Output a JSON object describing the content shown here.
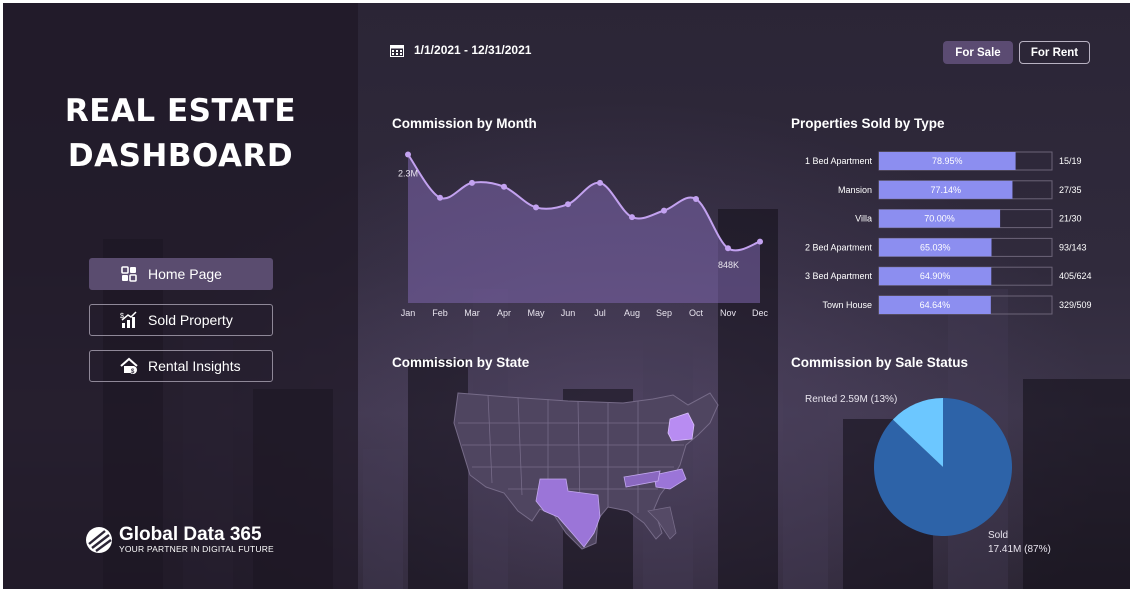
{
  "dashboard": {
    "title_line1": "REAL ESTATE",
    "title_line2": "DASHBOARD"
  },
  "nav": [
    {
      "label": "Home Page",
      "icon": "dashboard-icon",
      "active": true
    },
    {
      "label": "Sold Property",
      "icon": "growth-chart-icon",
      "active": false
    },
    {
      "label": "Rental Insights",
      "icon": "house-dollar-icon",
      "active": false
    }
  ],
  "brand": {
    "name": "Global Data 365",
    "tagline": "YOUR PARTNER IN DIGITAL FUTURE",
    "logo_icon": "globe-logo-icon"
  },
  "filters": {
    "date_range": "1/1/2021 - 12/31/2021",
    "date_icon": "calendar-icon",
    "for_sale": "For Sale",
    "for_rent": "For Rent",
    "selected": "For Sale"
  },
  "colors": {
    "accent": "#5b4b72",
    "line": "#c3a2f0",
    "area": "#7e66ad",
    "bar": "#8c8ef0",
    "pie_sold": "#2d63a8",
    "pie_rented": "#6cc7ff",
    "map_highlight": "#9b75d8"
  },
  "chart_data": [
    {
      "type": "area",
      "title": "Commission by Month",
      "categories": [
        "Jan",
        "Feb",
        "Mar",
        "Apr",
        "May",
        "Jun",
        "Jul",
        "Aug",
        "Sep",
        "Oct",
        "Nov",
        "Dec"
      ],
      "values": [
        2.3,
        1.63,
        1.86,
        1.8,
        1.48,
        1.53,
        1.86,
        1.33,
        1.43,
        1.61,
        0.848,
        0.95
      ],
      "value_unit": "M",
      "data_labels": [
        {
          "index": 0,
          "text": "2.3M"
        },
        {
          "index": 10,
          "text": "848K"
        }
      ],
      "ylim": [
        0,
        2.4
      ]
    },
    {
      "type": "bar",
      "title": "Properties Sold by Type",
      "categories": [
        "1 Bed Apartment",
        "Mansion",
        "Villa",
        "2 Bed Apartment",
        "3 Bed Apartment",
        "Town House"
      ],
      "values": [
        78.95,
        77.14,
        70.0,
        65.03,
        64.9,
        64.64
      ],
      "value_labels": [
        "78.95%",
        "77.14%",
        "70.00%",
        "65.03%",
        "64.90%",
        "64.64%"
      ],
      "ratios": [
        "15/19",
        "27/35",
        "21/30",
        "93/143",
        "405/624",
        "329/509"
      ],
      "xlim": [
        0,
        100
      ]
    },
    {
      "type": "pie",
      "title": "Commission by Sale Status",
      "slices": [
        {
          "label": "Sold",
          "value": 17.41,
          "display": "17.41M (87%)"
        },
        {
          "label": "Rented",
          "value": 2.59,
          "display": "2.59M (13%)"
        }
      ]
    },
    {
      "type": "map",
      "title": "Commission by State",
      "highlighted_states": [
        "New York",
        "Texas",
        "North Carolina",
        "Tennessee"
      ]
    }
  ]
}
